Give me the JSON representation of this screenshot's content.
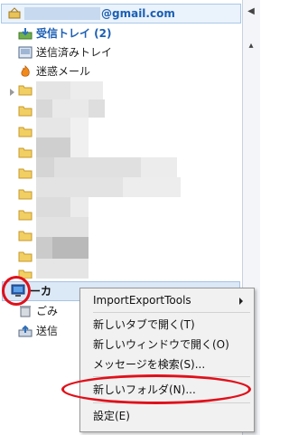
{
  "account": {
    "email_suffix": "@gmail.com"
  },
  "folders": {
    "inbox": "受信トレイ (2)",
    "sent": "送信済みトレイ",
    "junk": "迷惑メール"
  },
  "local": {
    "label_partial": "ーカ",
    "trash_partial": "ごみ",
    "outbox_partial": "送信"
  },
  "context_menu": {
    "items": [
      {
        "label": "ImportExportTools",
        "submenu": true
      },
      {
        "label": "新しいタブで開く(T)"
      },
      {
        "label": "新しいウィンドウで開く(O)"
      },
      {
        "label": "メッセージを検索(S)..."
      },
      {
        "label": "新しいフォルダ(N)...",
        "highlighted": true
      },
      {
        "label": "設定(E)"
      }
    ]
  },
  "colors": {
    "annotation": "#e0101a",
    "accent": "#1b5fb4"
  }
}
